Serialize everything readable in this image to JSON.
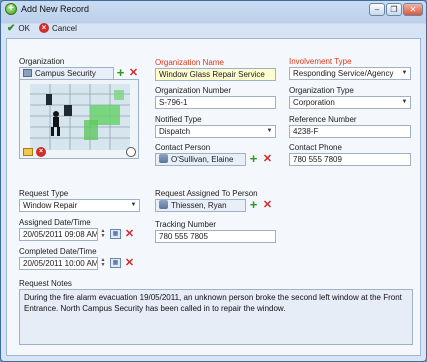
{
  "window": {
    "title": "Add New Record",
    "controls": {
      "minimize": "–",
      "restore": "❐",
      "close": "✕"
    }
  },
  "toolbar": {
    "ok_label": "OK",
    "cancel_label": "Cancel"
  },
  "organization": {
    "label": "Organization",
    "value": "Campus Security"
  },
  "organization_name": {
    "label": "Organization Name",
    "value": "Window Glass Repair Service"
  },
  "involvement_type": {
    "label": "Involvement Type",
    "value": "Responding Service/Agency"
  },
  "organization_number": {
    "label": "Organization Number",
    "value": "S-796-1"
  },
  "organization_type": {
    "label": "Organization Type",
    "value": "Corporation"
  },
  "notified_type": {
    "label": "Notified Type",
    "value": "Dispatch"
  },
  "reference_number": {
    "label": "Reference Number",
    "value": "4238-F"
  },
  "contact_person": {
    "label": "Contact Person",
    "value": "O'Sullivan, Elaine"
  },
  "contact_phone": {
    "label": "Contact Phone",
    "value": "780 555 7809"
  },
  "request_type": {
    "label": "Request Type",
    "value": "Window Repair"
  },
  "request_assigned_to": {
    "label": "Request Assigned To Person",
    "value": "Thiessen, Ryan"
  },
  "assigned_datetime": {
    "label": "Assigned Date/Time",
    "value": "20/05/2011 09:08 AM"
  },
  "tracking_number": {
    "label": "Tracking Number",
    "value": "780 555 7805"
  },
  "completed_datetime": {
    "label": "Completed Date/Time",
    "value": "20/05/2011 10:00 AM"
  },
  "request_notes": {
    "label": "Request Notes",
    "value": "During the fire alarm evacuation 19/05/2011, an unknown person broke the second left window at the Front Entrance. North Campus Security has been called in to repair the window."
  },
  "colors": {
    "required_label": "#e0391d",
    "panel_bg": "#f4f7fb",
    "highlight_field": "#fdfdce"
  }
}
